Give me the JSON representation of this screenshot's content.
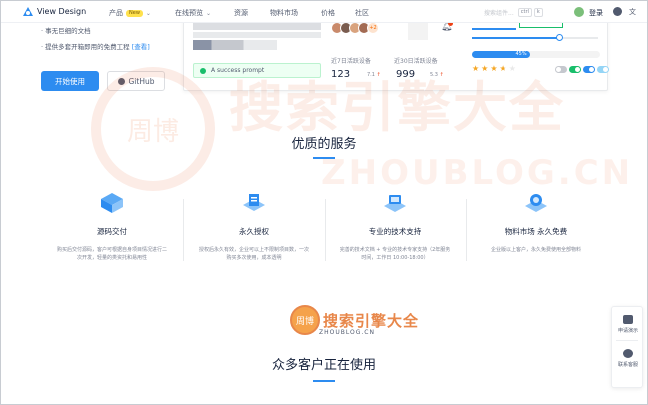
{
  "nav": {
    "brand": "View Design",
    "items": [
      {
        "label": "产品",
        "badge": "New",
        "caret": "⌄"
      },
      {
        "label": "在线预览",
        "caret": "⌄"
      },
      {
        "label": "资源"
      },
      {
        "label": "物料市场"
      },
      {
        "label": "价格"
      },
      {
        "label": "社区"
      }
    ],
    "search_placeholder": "搜索组件...",
    "search_shortcut": [
      "ctrl",
      "k"
    ],
    "login": "登录",
    "icons": [
      "github-icon",
      "translate-icon"
    ]
  },
  "hero": {
    "bullets": [
      "事无巨细的文档",
      "提供多套开箱即用的免费工程"
    ],
    "bullet_link": "[查看]",
    "start_button": "开始使用",
    "github_button": "GitHub"
  },
  "demo": {
    "avatars_more": "+2",
    "alert_text": "A success prompt",
    "stat7_label": "近7日活跃设备",
    "stat7_value": "123",
    "stat7_change": "7.1",
    "stat30_label": "近30日活跃设备",
    "stat30_value": "999",
    "stat30_change": "5.3",
    "slider_value": 0.7,
    "progress_percent": "45%",
    "progress_value": 0.45,
    "rating": 3.5,
    "rating_max": 5
  },
  "watermark": {
    "big_title": "搜索引擎大全",
    "big_domain": "ZHOUBLOG.CN",
    "seal": "周博",
    "small_title": "搜索引擎大全",
    "small_domain": "ZHOUBLOG.CN"
  },
  "services": {
    "title": "优质的服务",
    "items": [
      {
        "title": "源码交付",
        "desc": "购买后交付源码，客户可根据自身项目情况进行二次开发，轻量的类资托和易用性"
      },
      {
        "title": "永久授权",
        "desc": "授权后永久有效，企业可以上不限制项目数，一次购买多次使用，成本透明"
      },
      {
        "title": "专业的技术支持",
        "desc": "完善的技术文档 + 专业的技术专家支持（2年服务时间，工作日 10:00-18:00）"
      },
      {
        "title": "物料市场 永久免费",
        "desc": "企业版以上客户，永久免费使用全部物料"
      }
    ]
  },
  "customers": {
    "title": "众多客户正在使用"
  },
  "side": {
    "demo_label": "申请演示",
    "contact_label": "联系客服"
  },
  "colors": {
    "primary": "#2d8cf0",
    "success": "#19be6b",
    "star": "#f5a623",
    "watermark": "#e8874a"
  }
}
